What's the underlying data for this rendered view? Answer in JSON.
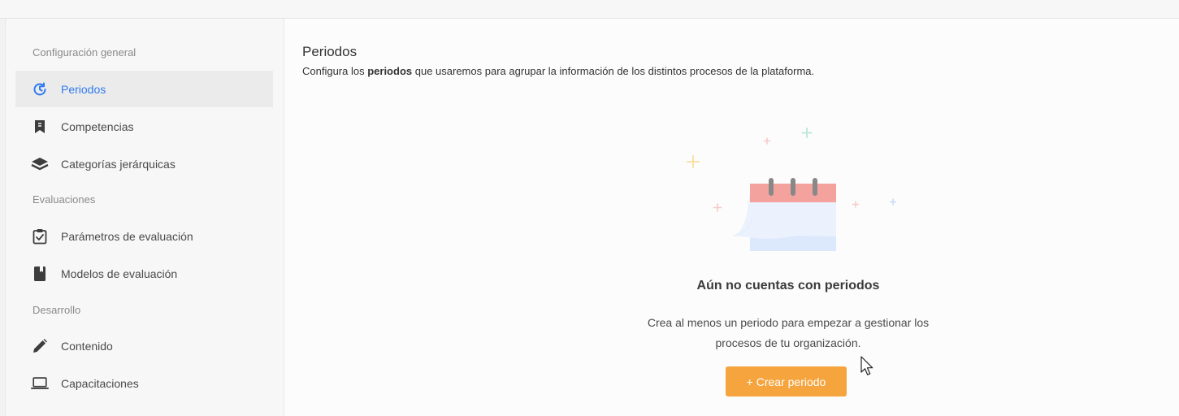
{
  "sidebar": {
    "sections": [
      {
        "title": "Configuración general",
        "items": [
          {
            "label": "Periodos",
            "icon": "clock-refresh-icon"
          },
          {
            "label": "Competencias",
            "icon": "bookmark-icon"
          },
          {
            "label": "Categorías jerárquicas",
            "icon": "layers-icon"
          }
        ]
      },
      {
        "title": "Evaluaciones",
        "items": [
          {
            "label": "Parámetros de evaluación",
            "icon": "clipboard-check-icon"
          },
          {
            "label": "Modelos de evaluación",
            "icon": "book-icon"
          }
        ]
      },
      {
        "title": "Desarrollo",
        "items": [
          {
            "label": "Contenido",
            "icon": "pencil-icon"
          },
          {
            "label": "Capacitaciones",
            "icon": "laptop-icon"
          }
        ]
      }
    ],
    "active_item": "Periodos"
  },
  "main": {
    "title": "Periodos",
    "description_prefix": "Configura los ",
    "description_bold": "periodos",
    "description_suffix": " que usaremos para agrupar la información de los distintos procesos de la plataforma.",
    "empty_state": {
      "illustration": "calendar-icon",
      "title": "Aún no cuentas con periodos",
      "description_line1": "Crea al menos un periodo para empezar a gestionar los",
      "description_line2": "procesos de tu organización.",
      "button_label": "+ Crear periodo"
    }
  },
  "colors": {
    "accent_blue": "#2f7bf0",
    "button_orange": "#f6a43e",
    "calendar_header": "#f29c98",
    "calendar_body": "#dde9fb"
  }
}
